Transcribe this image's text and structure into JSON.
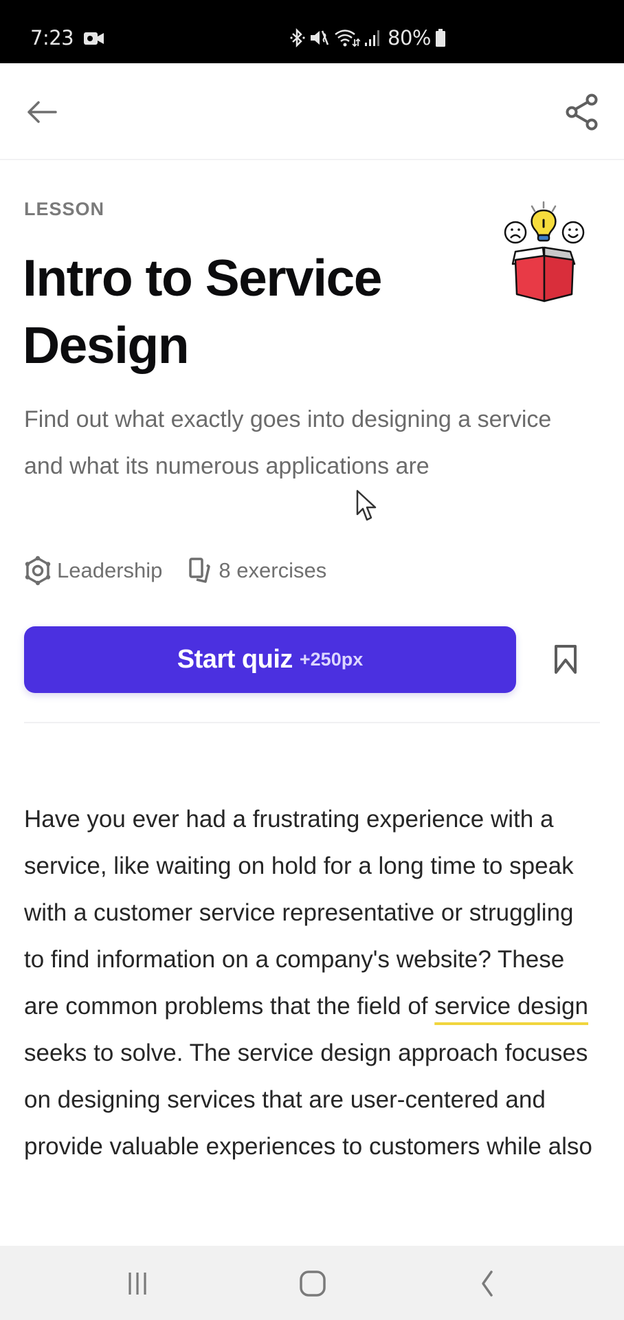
{
  "status_bar": {
    "time": "7:23",
    "battery_percent": "80%",
    "icons": [
      "screen-record-icon",
      "bluetooth-icon",
      "mute-icon",
      "wifi-icon",
      "signal-icon",
      "battery-icon"
    ]
  },
  "app_bar": {
    "back_icon": "arrow-left-icon",
    "share_icon": "share-icon"
  },
  "lesson": {
    "eyebrow": "LESSON",
    "title": "Intro to Service Design",
    "subtitle": "Find out what exactly goes into designing a service and what its numerous applications are",
    "illustration": "open-box-ideas-illustration",
    "meta": {
      "category": "Leadership",
      "category_icon": "leadership-hexagon-icon",
      "exercises": "8 exercises",
      "exercises_icon": "cards-icon"
    },
    "cta": {
      "label": "Start quiz",
      "points": "+250px",
      "color": "#4b30e0"
    },
    "bookmark_icon": "bookmark-icon"
  },
  "body": {
    "before_term": "Have you ever had a frustrating experience with a service, like waiting on hold for a long time to speak with a customer service representative or struggling to find information on a company's website? These are common problems that the field of ",
    "term": "service design",
    "after_term": " seeks to solve. The service design approach focuses on designing services that are user-centered and provide valuable experiences to customers while also",
    "term_underline_color": "#f1d53d"
  },
  "nav_bar": {
    "recents_icon": "recents-icon",
    "home_icon": "home-icon",
    "back_icon": "nav-back-icon"
  }
}
